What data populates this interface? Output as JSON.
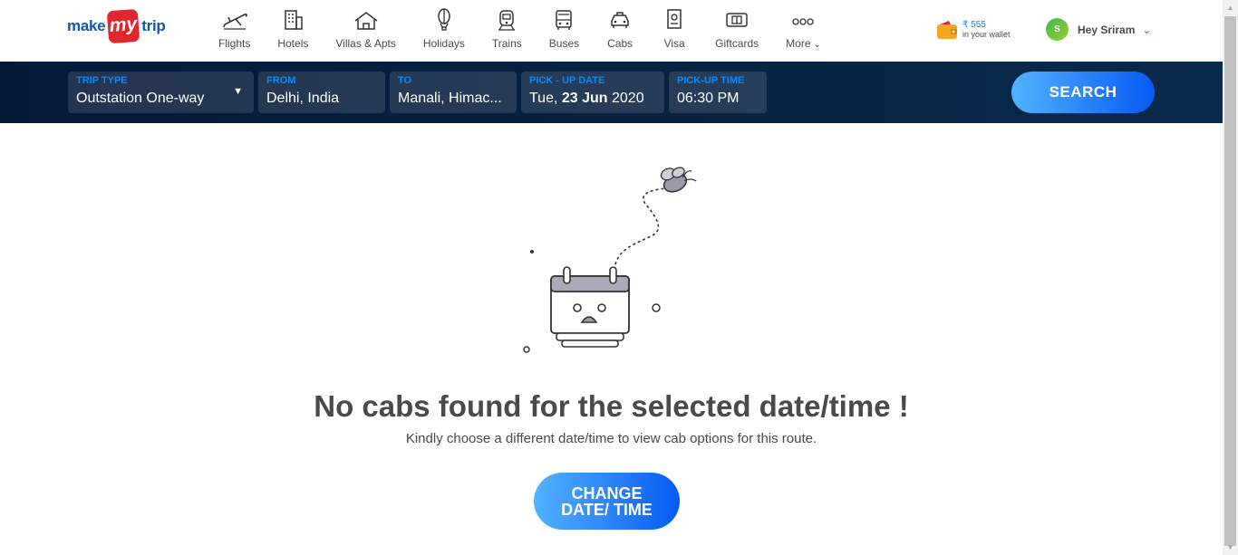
{
  "logo": {
    "make": "make",
    "my": "my",
    "trip": "trip"
  },
  "nav": [
    {
      "label": "Flights",
      "icon": "flight-icon"
    },
    {
      "label": "Hotels",
      "icon": "hotel-icon"
    },
    {
      "label": "Villas & Apts",
      "icon": "villa-icon"
    },
    {
      "label": "Holidays",
      "icon": "holiday-balloon-icon"
    },
    {
      "label": "Trains",
      "icon": "train-icon"
    },
    {
      "label": "Buses",
      "icon": "bus-icon"
    },
    {
      "label": "Cabs",
      "icon": "cab-icon"
    },
    {
      "label": "Visa",
      "icon": "visa-icon"
    },
    {
      "label": "Giftcards",
      "icon": "giftcard-icon"
    },
    {
      "label": "More",
      "icon": "more-dots-icon"
    }
  ],
  "wallet": {
    "amount": "₹ 555",
    "caption": "in your wallet"
  },
  "user": {
    "initial": "S",
    "greeting": "Hey Sriram"
  },
  "search": {
    "trip_type_label": "TRIP TYPE",
    "trip_type_value": "Outstation One-way",
    "from_label": "FROM",
    "from_value": "Delhi, India",
    "to_label": "TO",
    "to_value": "Manali, Himac...",
    "pickup_date_label": "PICK - UP DATE",
    "pickup_date_day": "Tue, ",
    "pickup_date_bold": "23 Jun",
    "pickup_date_year": " 2020",
    "pickup_time_label": "PICK-UP TIME",
    "pickup_time_value": "06:30 PM",
    "button_label": "SEARCH"
  },
  "empty_state": {
    "title": "No cabs found for the selected date/time !",
    "subtitle": "Kindly choose a different date/time to view cab options for this route.",
    "cta_line1": "CHANGE",
    "cta_line2": "DATE/ TIME"
  },
  "colors": {
    "brand_blue": "#008cff",
    "brand_red": "#e1262d",
    "navy": "#051937"
  }
}
